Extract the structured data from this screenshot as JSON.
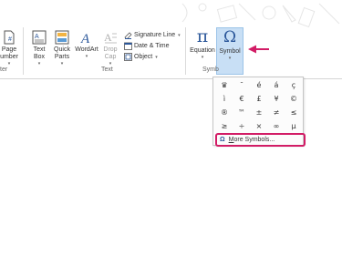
{
  "ribbon": {
    "page_number": {
      "line1": "Page",
      "line2": "umber"
    },
    "header_footer_label": "ter",
    "text_box": {
      "line1": "Text",
      "line2": "Box"
    },
    "quick_parts": {
      "line1": "Quick",
      "line2": "Parts"
    },
    "wordart": {
      "line1": "WordArt"
    },
    "drop_cap": {
      "line1": "Drop",
      "line2": "Cap"
    },
    "signature_line": "Signature Line",
    "date_time": "Date & Time",
    "object": "Object",
    "text_group_label": "Text",
    "equation": {
      "label": "Equation",
      "glyph": "π"
    },
    "symbol": {
      "label": "Symbol",
      "glyph": "Ω"
    },
    "symbols_group_label": "Symb",
    "accent_color": "#2b579a",
    "highlight_color": "#d21c66"
  },
  "symbol_menu": {
    "symbols": [
      "♛",
      "¯",
      "é",
      "á",
      "ç",
      "ì",
      "€",
      "£",
      "¥",
      "©",
      "®",
      "™",
      "±",
      "≠",
      "≤",
      "≥",
      "÷",
      "×",
      "∞",
      "µ"
    ],
    "more_icon": "Ω",
    "more_underlined": "M",
    "more_rest": "ore Symbols..."
  }
}
